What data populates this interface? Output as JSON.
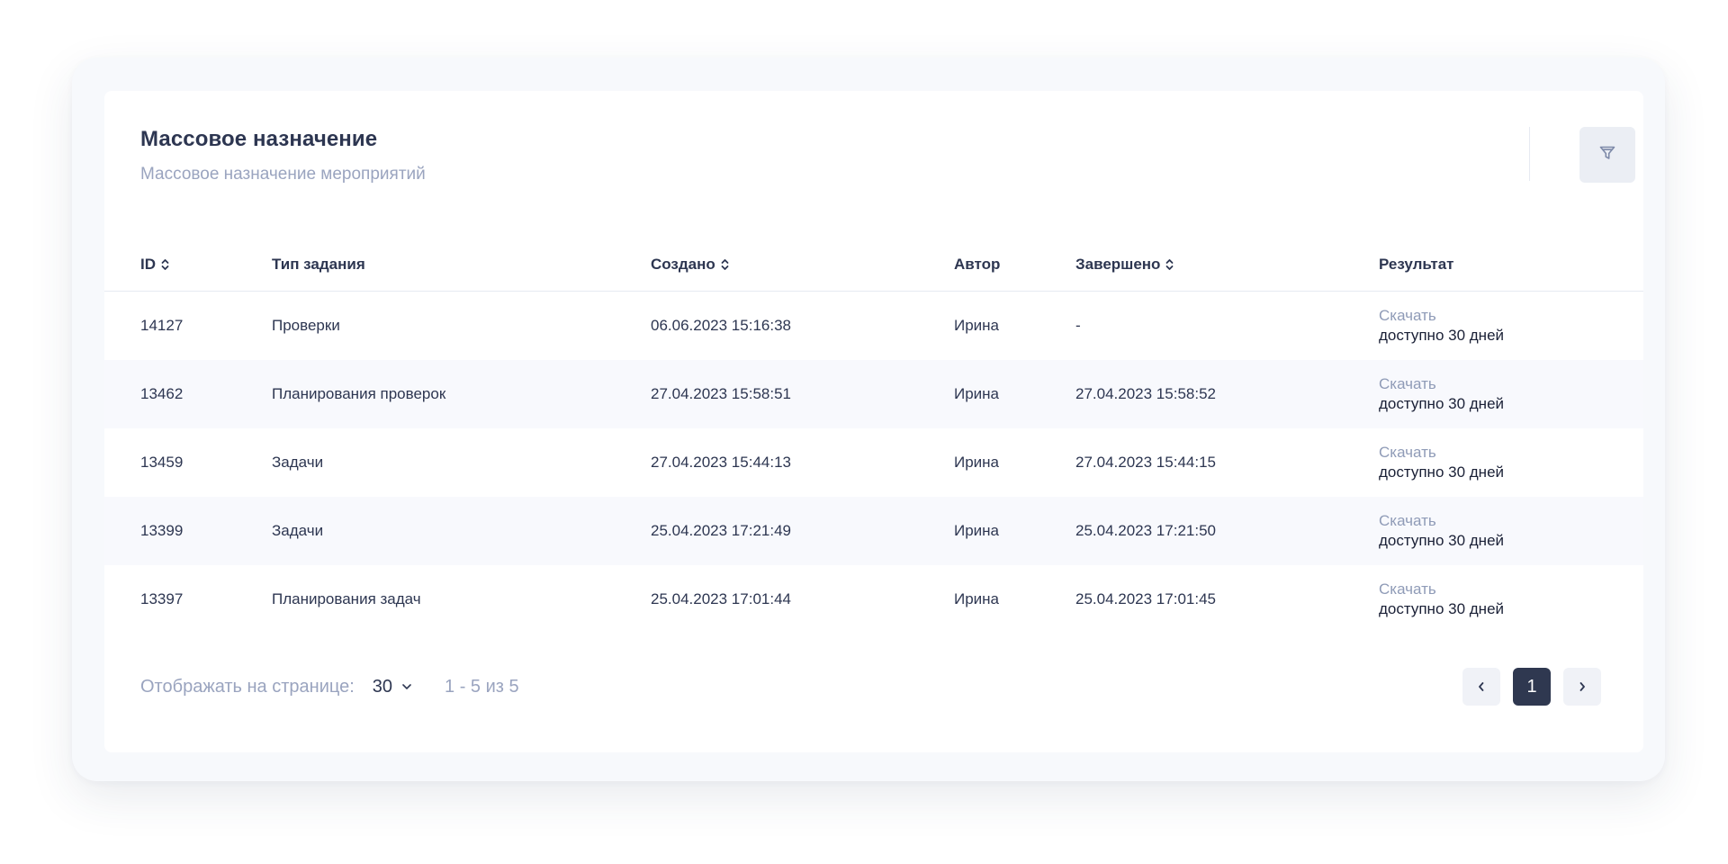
{
  "header": {
    "title": "Массовое назначение",
    "subtitle": "Массовое назначение мероприятий",
    "filter_icon": "filter-icon"
  },
  "table": {
    "columns": {
      "id": "ID",
      "type": "Тип задания",
      "created": "Создано",
      "author": "Автор",
      "done": "Завершено",
      "result": "Результат"
    },
    "rows": [
      {
        "id": "14127",
        "type": "Проверки",
        "created": "06.06.2023 15:16:38",
        "author": "Ирина",
        "done": "-",
        "link": "Скачать",
        "note": "доступно 30 дней"
      },
      {
        "id": "13462",
        "type": "Планирования проверок",
        "created": "27.04.2023 15:58:51",
        "author": "Ирина",
        "done": "27.04.2023 15:58:52",
        "link": "Скачать",
        "note": "доступно 30 дней"
      },
      {
        "id": "13459",
        "type": "Задачи",
        "created": "27.04.2023 15:44:13",
        "author": "Ирина",
        "done": "27.04.2023 15:44:15",
        "link": "Скачать",
        "note": "доступно 30 дней"
      },
      {
        "id": "13399",
        "type": "Задачи",
        "created": "25.04.2023 17:21:49",
        "author": "Ирина",
        "done": "25.04.2023 17:21:50",
        "link": "Скачать",
        "note": "доступно 30 дней"
      },
      {
        "id": "13397",
        "type": "Планирования задач",
        "created": "25.04.2023 17:01:44",
        "author": "Ирина",
        "done": "25.04.2023 17:01:45",
        "link": "Скачать",
        "note": "доступно 30 дней"
      }
    ]
  },
  "footer": {
    "per_page_label": "Отображать на странице:",
    "per_page_value": "30",
    "range": "1 - 5 из 5",
    "current_page": "1"
  },
  "colors": {
    "text": "#2d3651",
    "muted": "#9aa4bf",
    "active_page": "#2f3850",
    "row_alt": "#f8f9fd"
  }
}
